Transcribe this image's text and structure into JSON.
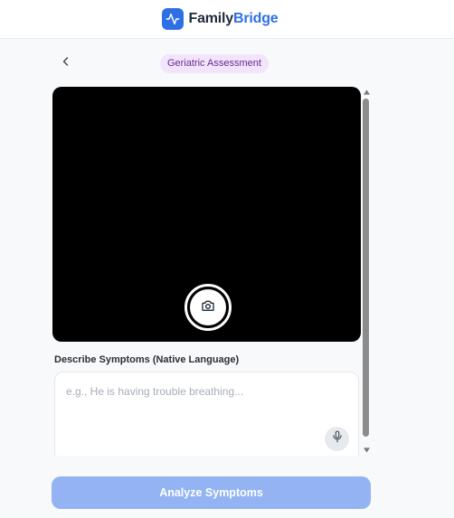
{
  "header": {
    "brand_part1": "Family",
    "brand_part2": "Bridge",
    "brand_color": "#2f6fe4",
    "logo_icon": "pulse-icon"
  },
  "nav": {
    "back_icon": "chevron-left-icon",
    "badge_label": "Geriatric Assessment"
  },
  "camera": {
    "capture_icon": "camera-icon"
  },
  "symptoms": {
    "label": "Describe Symptoms (Native Language)",
    "placeholder": "e.g., He is having trouble breathing...",
    "value": "",
    "mic_icon": "microphone-icon"
  },
  "actions": {
    "analyze_label": "Analyze Symptoms",
    "analyze_color": "#93b3f2"
  }
}
